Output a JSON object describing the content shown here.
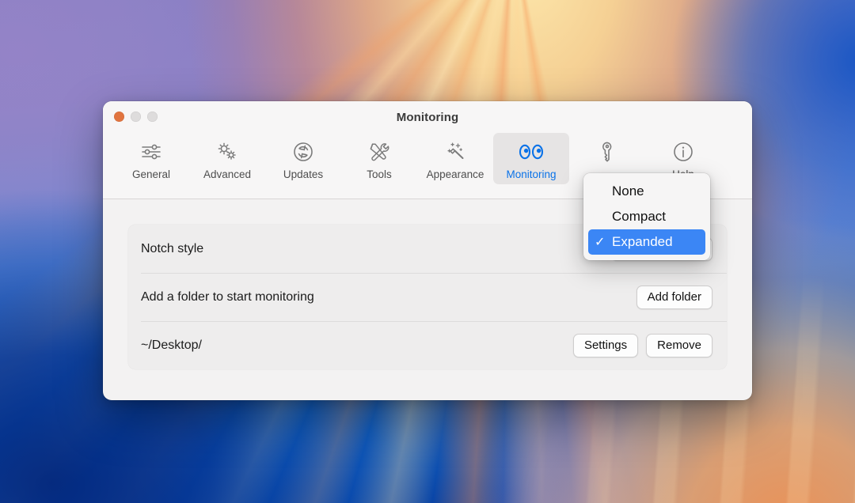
{
  "window": {
    "title": "Monitoring",
    "controls": [
      {
        "name": "close",
        "color": "#e1743f"
      },
      {
        "name": "minimize",
        "color": "#dedcdc"
      },
      {
        "name": "zoom",
        "color": "#dedcdc"
      }
    ]
  },
  "toolbar": {
    "items": [
      {
        "label": "General",
        "icon": "sliders-icon",
        "selected": false
      },
      {
        "label": "Advanced",
        "icon": "gears-icon",
        "selected": false
      },
      {
        "label": "Updates",
        "icon": "refresh-icon",
        "selected": false
      },
      {
        "label": "Tools",
        "icon": "tools-icon",
        "selected": false
      },
      {
        "label": "Appearance",
        "icon": "magicwand-icon",
        "selected": false
      },
      {
        "label": "Monitoring",
        "icon": "eyes-icon",
        "selected": true
      },
      {
        "label": "",
        "icon": "key-icon",
        "selected": false
      },
      {
        "label": "Help",
        "icon": "info-icon",
        "selected": false
      }
    ],
    "selected_color": "#0a72e8"
  },
  "rows": [
    {
      "label": "Notch style",
      "control": "popup-button",
      "value": "Expanded"
    },
    {
      "label": "Add a folder to start monitoring",
      "control": "button",
      "buttons": [
        "Add folder"
      ]
    },
    {
      "label": "~/Desktop/",
      "control": "buttons",
      "buttons": [
        "Settings",
        "Remove"
      ]
    }
  ],
  "menu": {
    "open": true,
    "highlight_color": "#3b86f5",
    "checkmark": "✓",
    "items": [
      {
        "label": "None",
        "checked": false,
        "highlighted": false
      },
      {
        "label": "Compact",
        "checked": false,
        "highlighted": false
      },
      {
        "label": "Expanded",
        "checked": true,
        "highlighted": true
      }
    ]
  }
}
